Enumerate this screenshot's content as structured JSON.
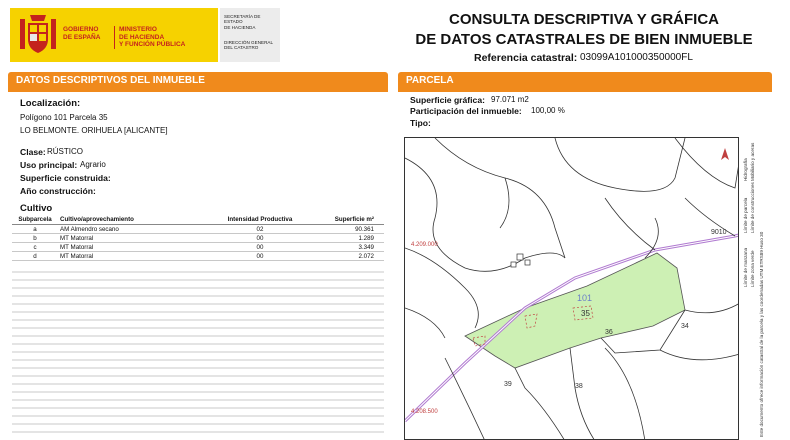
{
  "header": {
    "gob_line1": "GOBIERNO",
    "gob_line2": "DE ESPAÑA",
    "min_line1": "MINISTERIO",
    "min_line2": "DE HACIENDA",
    "min_line3": "Y FUNCIÓN PÚBLICA",
    "sec_line1": "SECRETARÍA DE ESTADO",
    "sec_line2": "DE HACIENDA",
    "dir_line1": "DIRECCIÓN GENERAL",
    "dir_line2": "DEL CATASTRO",
    "title_line1": "CONSULTA DESCRIPTIVA Y GRÁFICA",
    "title_line2": "DE DATOS CATASTRALES DE BIEN INMUEBLE",
    "ref_label": "Referencia catastral:",
    "ref_value": "03099A101000350000FL"
  },
  "left": {
    "section_title": "DATOS DESCRIPTIVOS DEL INMUEBLE",
    "localizacion_label": "Localización:",
    "localizacion_line1": "Polígono 101 Parcela 35",
    "localizacion_line2": "LO BELMONTE. ORIHUELA [ALICANTE]",
    "clase_label": "Clase:",
    "clase_value": "RÚSTICO",
    "uso_label": "Uso principal:",
    "uso_value": "Agrario",
    "superficie_label": "Superficie construida:",
    "anio_label": "Año construcción:",
    "cultivo_title": "Cultivo",
    "table_headers": [
      "Subparcela",
      "Cultivo/aprovechamiento",
      "Intensidad Productiva",
      "Superficie m²"
    ],
    "table_rows": [
      [
        "a",
        "AM Almendro secano",
        "02",
        "90.361"
      ],
      [
        "b",
        "MT Matorral",
        "00",
        "1.289"
      ],
      [
        "c",
        "MT Matorral",
        "00",
        "3.349"
      ],
      [
        "d",
        "MT Matorral",
        "00",
        "2.072"
      ]
    ]
  },
  "right": {
    "section_title": "PARCELA",
    "sup_grafica_label": "Superficie gráfica:",
    "sup_grafica_value": "97.071 m2",
    "participacion_label": "Participación del inmueble:",
    "participacion_value": "100,00 %",
    "tipo_label": "Tipo:",
    "map_labels": {
      "coord_top": "4.209.000",
      "coord_bottom": "4.208.500",
      "road_code": "9010",
      "parcel_main": "101",
      "parcel_35": "35",
      "parcel_36": "36",
      "parcel_34": "34",
      "parcel_39": "39",
      "parcel_38": "38"
    },
    "legend_lines": [
      "Límite de parcela",
      "Límite de construcciones",
      "Límite de manzana",
      "Hidrografía",
      "Límite zona verde",
      "Mobiliario y aceras"
    ],
    "legend_note": "Este documento ofrece información catastral de la parcela y las coordenadas UTM ETRS89 Huso 30"
  },
  "colors": {
    "accent": "#f08a1c",
    "parcel_fill": "#cdf0b4",
    "road": "#b07ad0",
    "logo_yellow": "#f6d200",
    "logo_red": "#c4231d"
  }
}
